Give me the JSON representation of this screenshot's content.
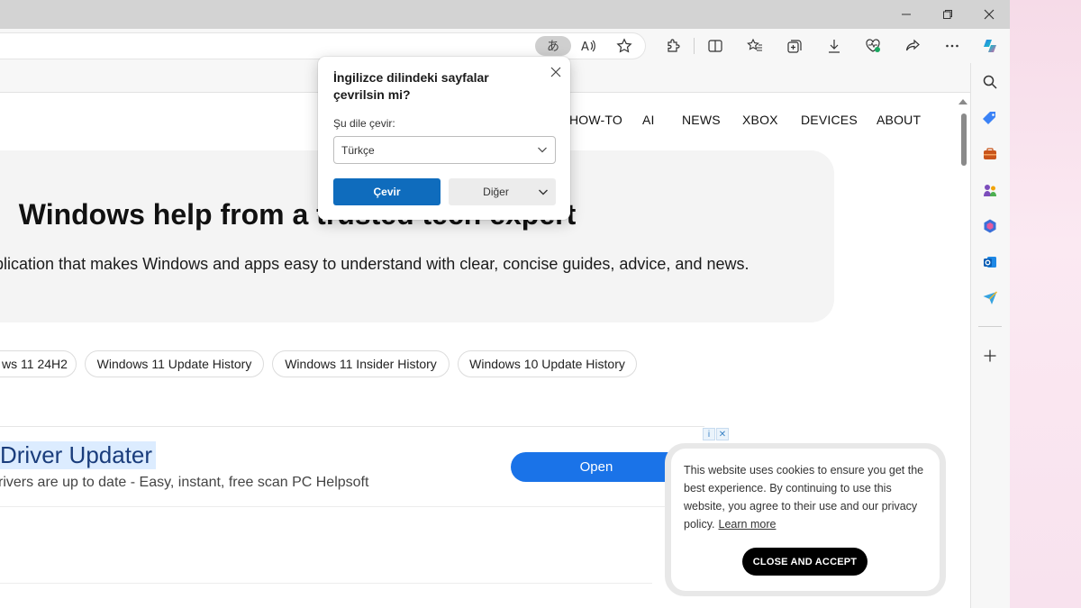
{
  "window": {
    "minimize_label": "—",
    "restore_label": "❐",
    "close_label": "✕"
  },
  "toolbar": {
    "translate_glyph": "あ",
    "icons": [
      "translate-icon",
      "read-aloud-icon",
      "add-favorite-icon",
      "extensions-icon",
      "split-screen-icon",
      "favorites-icon",
      "collections-icon",
      "downloads-icon",
      "browser-essentials-icon",
      "share-icon",
      "more-icon",
      "copilot-icon"
    ]
  },
  "sidebar": {
    "icons": [
      "search-icon",
      "shopping-icon",
      "tools-icon",
      "games-icon",
      "microsoft-365-icon",
      "outlook-icon",
      "drop-icon",
      "add-icon"
    ]
  },
  "site_nav": {
    "items": [
      "HOW-TO",
      "AI",
      "NEWS",
      "XBOX",
      "DEVICES",
      "ABOUT"
    ]
  },
  "hero": {
    "title": "Windows help from a trusted tech expert",
    "subtitle": "blication that makes Windows and apps easy to understand with clear, concise guides, advice, and news."
  },
  "chips": [
    "ws 11 24H2",
    "Windows 11 Update History",
    "Windows 11 Insider History",
    "Windows 10 Update History"
  ],
  "ad": {
    "title": "Driver Updater",
    "description": "rivers are up to date - Easy, instant, free scan PC Helpsoft",
    "button": "Open",
    "adchoices_info": "i",
    "adchoices_close": "✕"
  },
  "cookie": {
    "text": "This website uses cookies to ensure you get the best experience. By continuing to use this website, you agree to their use and our privacy policy.",
    "link": "Learn more",
    "button": "CLOSE AND ACCEPT"
  },
  "translate_popup": {
    "title": "İngilizce dilindeki sayfalar çevrilsin mi?",
    "label": "Şu dile çevir:",
    "selected_language": "Türkçe",
    "primary_button": "Çevir",
    "secondary_button": "Diğer"
  },
  "colors": {
    "accent": "#0f6cbd",
    "ad_button": "#1a73e8",
    "titlebar": "#d3d3d3"
  }
}
